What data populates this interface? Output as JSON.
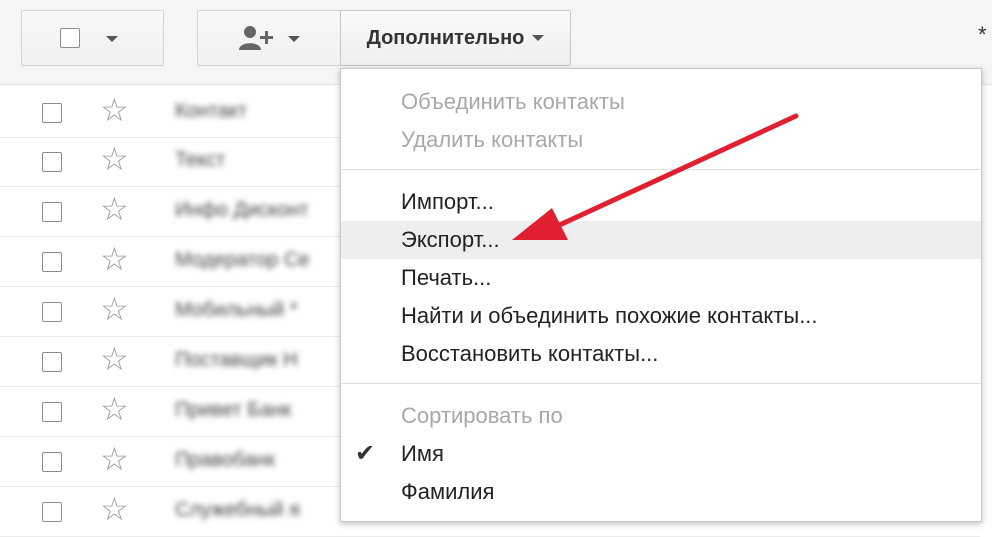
{
  "toolbar": {
    "select_icon": "checkbox-icon",
    "add_contact_icon": "add-person-icon",
    "more_label": "Дополнительно",
    "edge_glyph": "*"
  },
  "contacts": [
    {
      "name": "Контакт"
    },
    {
      "name": "Текст"
    },
    {
      "name": "Инфо Дисконт"
    },
    {
      "name": "Модератор Се"
    },
    {
      "name": "Мобильный *"
    },
    {
      "name": "Поставщик Н"
    },
    {
      "name": "Привет Банк"
    },
    {
      "name": "Правобанк"
    },
    {
      "name": "Служебный я"
    }
  ],
  "menu": {
    "items": [
      {
        "label": "Объединить контакты",
        "disabled": true
      },
      {
        "label": "Удалить контакты",
        "disabled": true
      },
      {
        "label": "Импорт...",
        "disabled": false
      },
      {
        "label": "Экспорт...",
        "disabled": false,
        "highlighted": true
      },
      {
        "label": "Печать...",
        "disabled": false
      },
      {
        "label": "Найти и объединить похожие контакты...",
        "disabled": false
      },
      {
        "label": "Восстановить контакты...",
        "disabled": false
      },
      {
        "label": "Сортировать по",
        "disabled": true
      },
      {
        "label": "Имя",
        "disabled": false,
        "checked": true
      },
      {
        "label": "Фамилия",
        "disabled": false
      }
    ],
    "check_glyph": "✔"
  },
  "colors": {
    "arrow": "#e02030",
    "hover": "#eeeeee",
    "disabled_text": "#a8a8a8"
  }
}
